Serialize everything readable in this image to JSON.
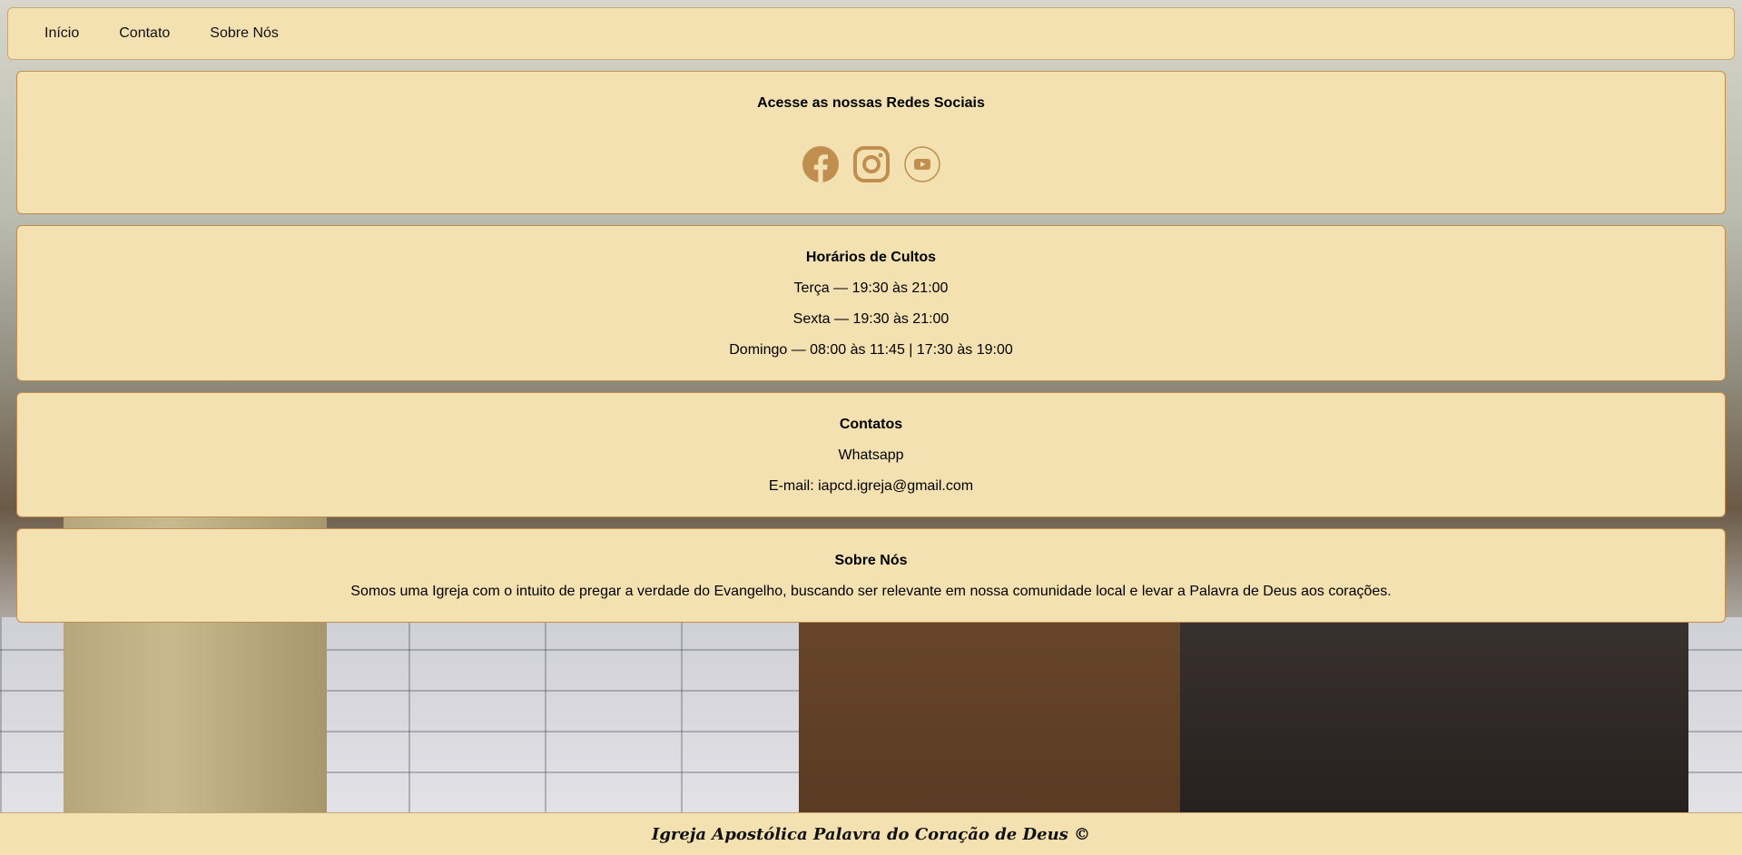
{
  "nav": {
    "items": [
      {
        "label": "Início"
      },
      {
        "label": "Contato"
      },
      {
        "label": "Sobre Nós"
      }
    ]
  },
  "social": {
    "title": "Acesse as nossas Redes Sociais",
    "icons": [
      "facebook-icon",
      "instagram-icon",
      "youtube-icon"
    ],
    "icon_color": "#c08e4f"
  },
  "horarios": {
    "title": "Horários de Cultos",
    "lines": [
      "Terça — 19:30 às 21:00",
      "Sexta — 19:30 às 21:00",
      "Domingo — 08:00 às 11:45 | 17:30 às 19:00"
    ]
  },
  "contatos": {
    "title": "Contatos",
    "whatsapp": "Whatsapp",
    "email": "E-mail: iapcd.igreja@gmail.com"
  },
  "sobre": {
    "title": "Sobre Nós",
    "text": "Somos uma Igreja com o intuito de pregar a verdade do Evangelho, buscando ser relevante em nossa comunidade local e levar a Palavra de Deus aos corações."
  },
  "footer": {
    "text": "Igreja Apostólica Palavra do Coração de Deus ©"
  },
  "colors": {
    "card_bg": "#f3e1b1",
    "card_border": "#c08e4f"
  }
}
